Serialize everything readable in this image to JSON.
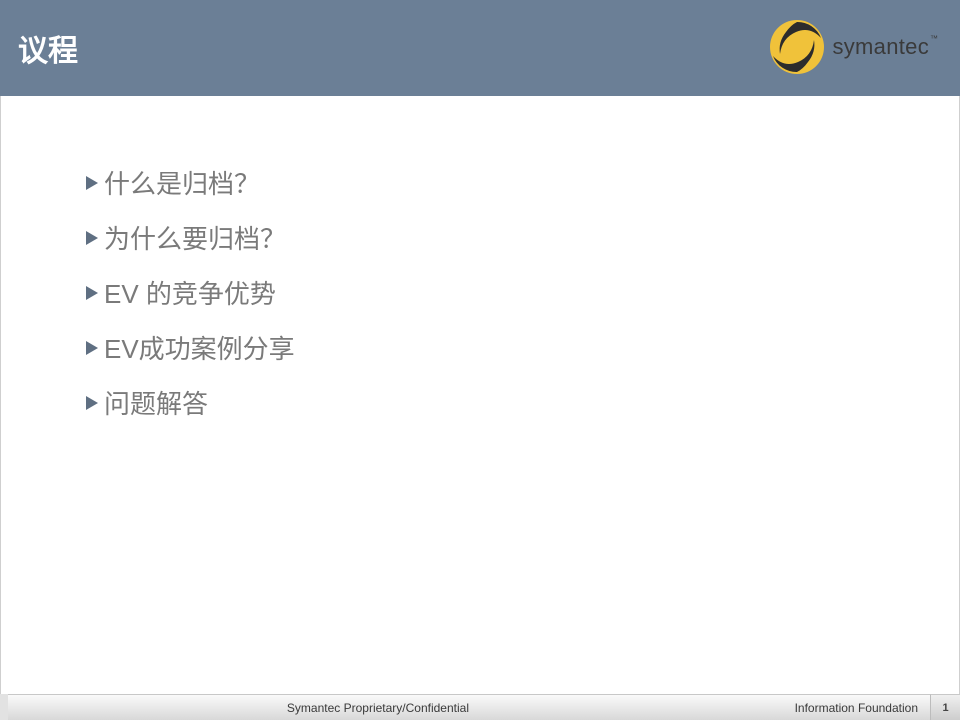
{
  "header": {
    "title": "议程",
    "logo_text": "symantec",
    "logo_tm": "™"
  },
  "agenda": {
    "items": [
      "什么是归档？",
      "为什么要归档？",
      "EV 的竞争优势",
      "EV成功案例分享",
      "问题解答"
    ]
  },
  "footer": {
    "confidential": "Symantec Proprietary/Confidential",
    "brand_line": "Information Foundation",
    "page_number": "1"
  }
}
